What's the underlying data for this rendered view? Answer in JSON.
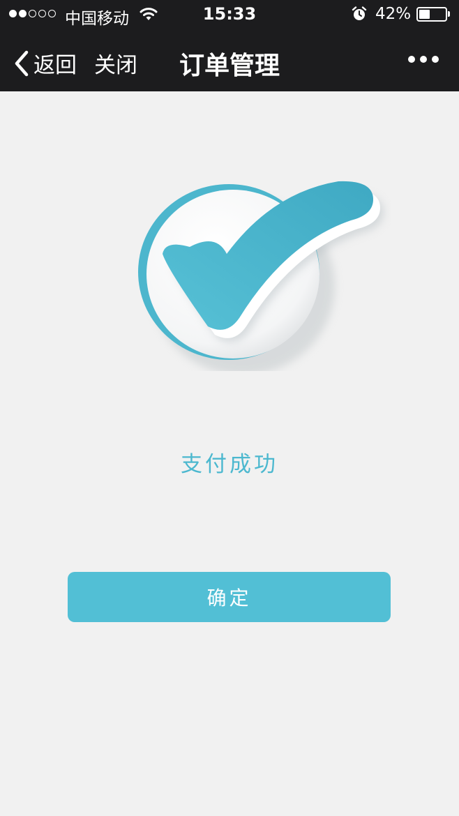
{
  "status_bar": {
    "carrier": "中国移动",
    "time": "15:33",
    "battery_percent": "42%",
    "battery_level": 0.42,
    "signal_bars_filled": 2,
    "signal_bars_total": 5
  },
  "nav": {
    "back_label": "返回",
    "close_label": "关闭",
    "title": "订单管理"
  },
  "main": {
    "status_text": "支付成功",
    "confirm_label": "确定"
  },
  "colors": {
    "accent": "#52bfd5",
    "nav_bg": "#1c1c1e",
    "page_bg": "#f1f1f1"
  },
  "icons": [
    "chevron-left-icon",
    "more-icon",
    "wifi-icon",
    "alarm-icon",
    "battery-icon",
    "check-success-icon"
  ]
}
